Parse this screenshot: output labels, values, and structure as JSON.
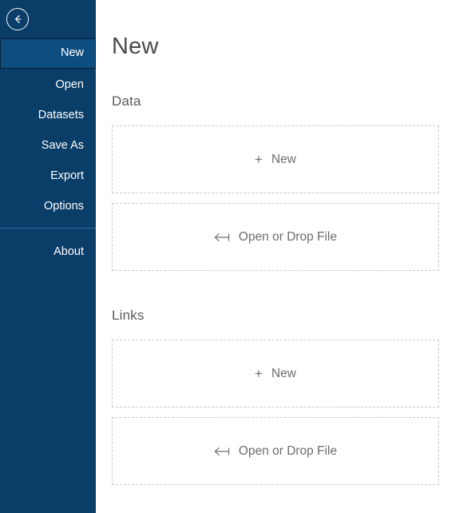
{
  "sidebar": {
    "back_button": {
      "name": "back-arrow-icon",
      "label": "Back"
    },
    "items": [
      {
        "label": "New",
        "selected": true,
        "icon": ""
      },
      {
        "label": "Open",
        "selected": false,
        "icon": ""
      },
      {
        "label": "Datasets",
        "selected": false,
        "icon": ""
      },
      {
        "label": "Save As",
        "selected": false,
        "icon": ""
      },
      {
        "label": "Export",
        "selected": false,
        "icon": ""
      },
      {
        "label": "Options",
        "selected": false,
        "icon": ""
      }
    ],
    "footer_items": [
      {
        "label": "About",
        "selected": false
      }
    ],
    "colors": {
      "background": "#0a3d68",
      "selected_background": "#0e4d80",
      "selected_border": "#071f35",
      "separator": "#2d6a97",
      "text": "#ffffff"
    }
  },
  "main": {
    "title": "New",
    "sections": [
      {
        "id": "data",
        "title": "Data",
        "cards": [
          {
            "id": "data-new",
            "icon": "plus-icon",
            "label": "New"
          },
          {
            "id": "data-open",
            "icon": "open-file-arrow-icon",
            "label": "Open or Drop File"
          }
        ]
      },
      {
        "id": "links",
        "title": "Links",
        "cards": [
          {
            "id": "links-new",
            "icon": "plus-icon",
            "label": "New"
          },
          {
            "id": "links-open",
            "icon": "open-file-arrow-icon",
            "label": "Open or Drop File"
          }
        ]
      }
    ],
    "icons": {
      "plus_glyph": "+"
    },
    "colors": {
      "background": "#ffffff",
      "title_text": "#4a4a4a",
      "section_text": "#5a5a5a",
      "card_text": "#6d6d6d",
      "card_border": "#c9c9c9"
    }
  }
}
